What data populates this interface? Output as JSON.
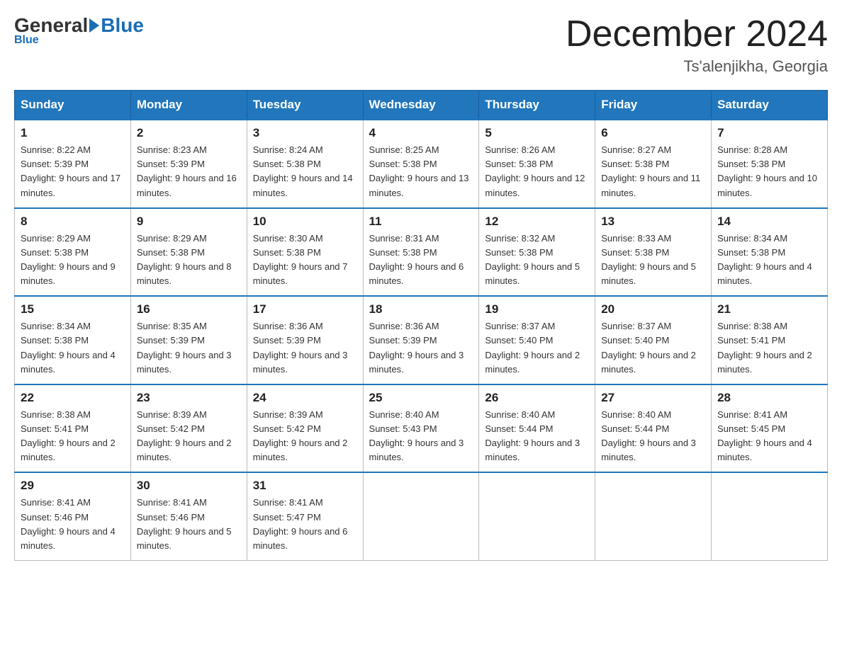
{
  "header": {
    "logo_general": "General",
    "logo_blue": "Blue",
    "month_title": "December 2024",
    "location": "Ts'alenjikha, Georgia"
  },
  "days_of_week": [
    "Sunday",
    "Monday",
    "Tuesday",
    "Wednesday",
    "Thursday",
    "Friday",
    "Saturday"
  ],
  "weeks": [
    [
      {
        "num": "1",
        "sunrise": "8:22 AM",
        "sunset": "5:39 PM",
        "daylight": "9 hours and 17 minutes."
      },
      {
        "num": "2",
        "sunrise": "8:23 AM",
        "sunset": "5:39 PM",
        "daylight": "9 hours and 16 minutes."
      },
      {
        "num": "3",
        "sunrise": "8:24 AM",
        "sunset": "5:38 PM",
        "daylight": "9 hours and 14 minutes."
      },
      {
        "num": "4",
        "sunrise": "8:25 AM",
        "sunset": "5:38 PM",
        "daylight": "9 hours and 13 minutes."
      },
      {
        "num": "5",
        "sunrise": "8:26 AM",
        "sunset": "5:38 PM",
        "daylight": "9 hours and 12 minutes."
      },
      {
        "num": "6",
        "sunrise": "8:27 AM",
        "sunset": "5:38 PM",
        "daylight": "9 hours and 11 minutes."
      },
      {
        "num": "7",
        "sunrise": "8:28 AM",
        "sunset": "5:38 PM",
        "daylight": "9 hours and 10 minutes."
      }
    ],
    [
      {
        "num": "8",
        "sunrise": "8:29 AM",
        "sunset": "5:38 PM",
        "daylight": "9 hours and 9 minutes."
      },
      {
        "num": "9",
        "sunrise": "8:29 AM",
        "sunset": "5:38 PM",
        "daylight": "9 hours and 8 minutes."
      },
      {
        "num": "10",
        "sunrise": "8:30 AM",
        "sunset": "5:38 PM",
        "daylight": "9 hours and 7 minutes."
      },
      {
        "num": "11",
        "sunrise": "8:31 AM",
        "sunset": "5:38 PM",
        "daylight": "9 hours and 6 minutes."
      },
      {
        "num": "12",
        "sunrise": "8:32 AM",
        "sunset": "5:38 PM",
        "daylight": "9 hours and 5 minutes."
      },
      {
        "num": "13",
        "sunrise": "8:33 AM",
        "sunset": "5:38 PM",
        "daylight": "9 hours and 5 minutes."
      },
      {
        "num": "14",
        "sunrise": "8:34 AM",
        "sunset": "5:38 PM",
        "daylight": "9 hours and 4 minutes."
      }
    ],
    [
      {
        "num": "15",
        "sunrise": "8:34 AM",
        "sunset": "5:38 PM",
        "daylight": "9 hours and 4 minutes."
      },
      {
        "num": "16",
        "sunrise": "8:35 AM",
        "sunset": "5:39 PM",
        "daylight": "9 hours and 3 minutes."
      },
      {
        "num": "17",
        "sunrise": "8:36 AM",
        "sunset": "5:39 PM",
        "daylight": "9 hours and 3 minutes."
      },
      {
        "num": "18",
        "sunrise": "8:36 AM",
        "sunset": "5:39 PM",
        "daylight": "9 hours and 3 minutes."
      },
      {
        "num": "19",
        "sunrise": "8:37 AM",
        "sunset": "5:40 PM",
        "daylight": "9 hours and 2 minutes."
      },
      {
        "num": "20",
        "sunrise": "8:37 AM",
        "sunset": "5:40 PM",
        "daylight": "9 hours and 2 minutes."
      },
      {
        "num": "21",
        "sunrise": "8:38 AM",
        "sunset": "5:41 PM",
        "daylight": "9 hours and 2 minutes."
      }
    ],
    [
      {
        "num": "22",
        "sunrise": "8:38 AM",
        "sunset": "5:41 PM",
        "daylight": "9 hours and 2 minutes."
      },
      {
        "num": "23",
        "sunrise": "8:39 AM",
        "sunset": "5:42 PM",
        "daylight": "9 hours and 2 minutes."
      },
      {
        "num": "24",
        "sunrise": "8:39 AM",
        "sunset": "5:42 PM",
        "daylight": "9 hours and 2 minutes."
      },
      {
        "num": "25",
        "sunrise": "8:40 AM",
        "sunset": "5:43 PM",
        "daylight": "9 hours and 3 minutes."
      },
      {
        "num": "26",
        "sunrise": "8:40 AM",
        "sunset": "5:44 PM",
        "daylight": "9 hours and 3 minutes."
      },
      {
        "num": "27",
        "sunrise": "8:40 AM",
        "sunset": "5:44 PM",
        "daylight": "9 hours and 3 minutes."
      },
      {
        "num": "28",
        "sunrise": "8:41 AM",
        "sunset": "5:45 PM",
        "daylight": "9 hours and 4 minutes."
      }
    ],
    [
      {
        "num": "29",
        "sunrise": "8:41 AM",
        "sunset": "5:46 PM",
        "daylight": "9 hours and 4 minutes."
      },
      {
        "num": "30",
        "sunrise": "8:41 AM",
        "sunset": "5:46 PM",
        "daylight": "9 hours and 5 minutes."
      },
      {
        "num": "31",
        "sunrise": "8:41 AM",
        "sunset": "5:47 PM",
        "daylight": "9 hours and 6 minutes."
      },
      null,
      null,
      null,
      null
    ]
  ]
}
